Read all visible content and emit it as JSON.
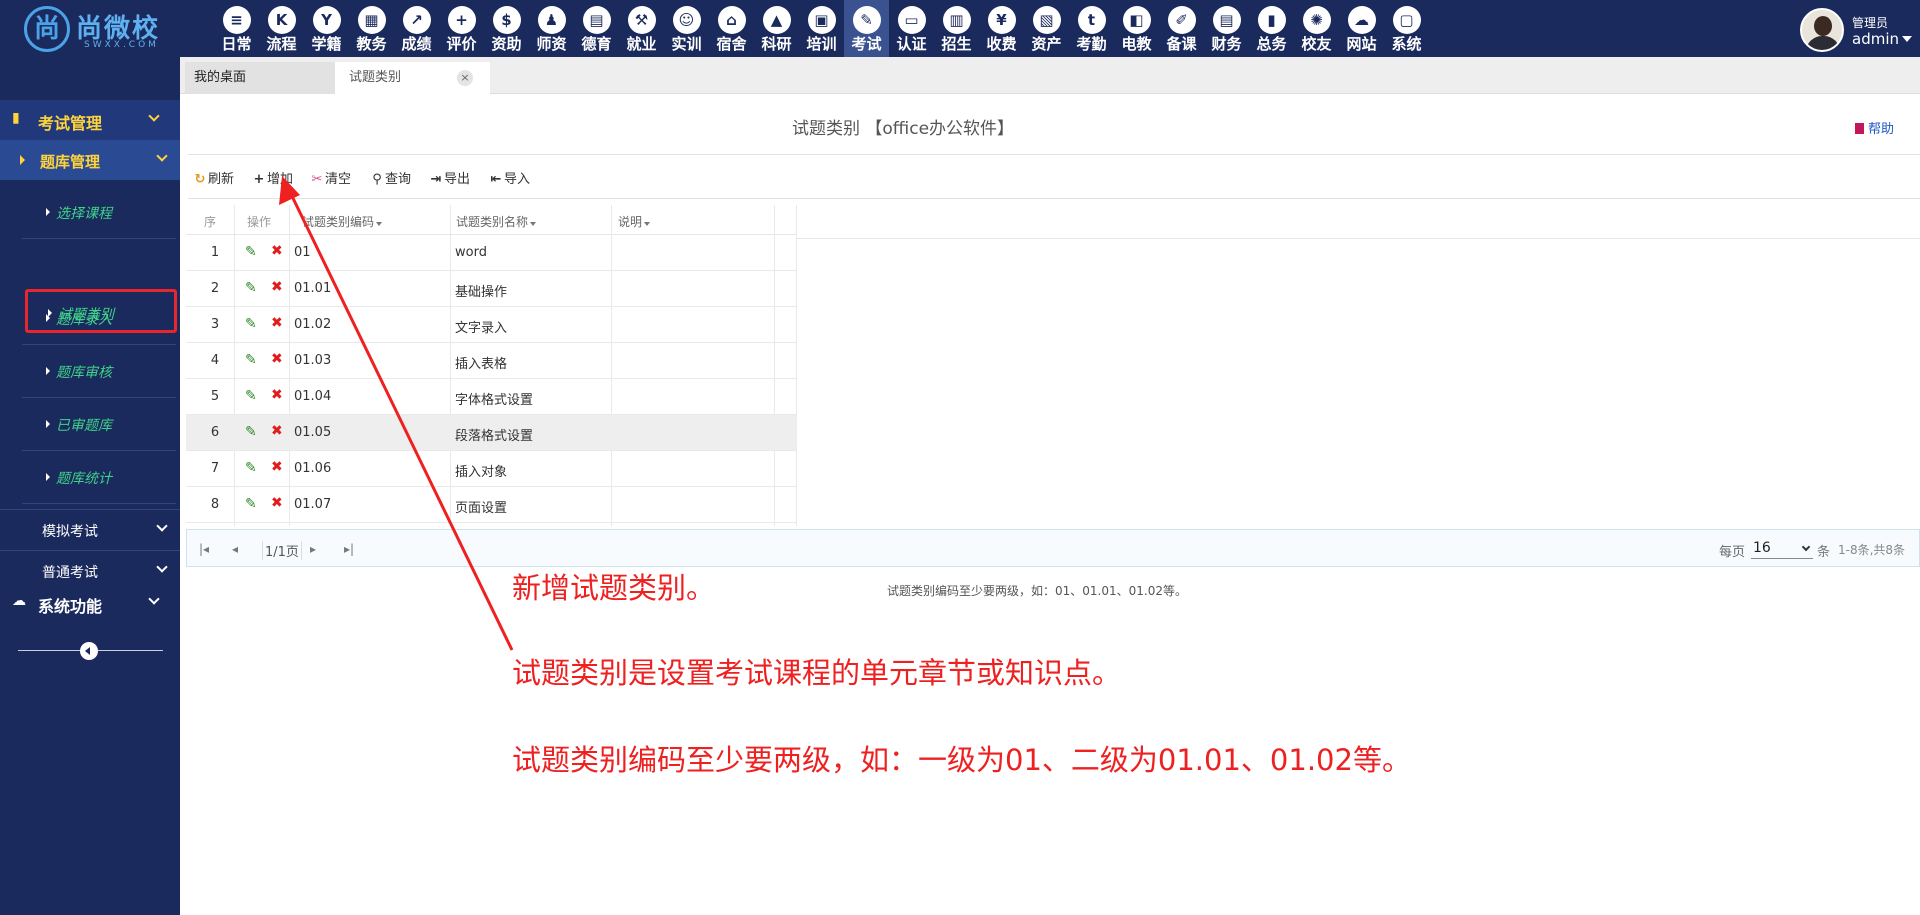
{
  "logo": {
    "mark": "尚",
    "name": "尚微校",
    "sub": "SWXX.COM"
  },
  "modules": [
    "日常",
    "流程",
    "学籍",
    "教务",
    "成绩",
    "评价",
    "资助",
    "师资",
    "德育",
    "就业",
    "实训",
    "宿舍",
    "科研",
    "培训",
    "考试",
    "认证",
    "招生",
    "收费",
    "资产",
    "考勤",
    "电教",
    "备课",
    "财务",
    "总务",
    "校友",
    "网站",
    "系统"
  ],
  "module_icons": [
    "≡",
    "K",
    "Y",
    "▦",
    "↗",
    "+",
    "$",
    "♟",
    "▤",
    "⚒",
    "☺",
    "⌂",
    "▲",
    "▣",
    "✎",
    "▭",
    "▥",
    "¥",
    "▧",
    "t",
    "◧",
    "✐",
    "▤",
    "▮",
    "✺",
    "☁",
    "▢"
  ],
  "active_module_index": 14,
  "user": {
    "role": "管理员",
    "name": "admin"
  },
  "sidebar": {
    "section_exam": "考试管理",
    "section_bank": "题库管理",
    "items": [
      "选择课程",
      "试题类别",
      "题库录入",
      "题库审核",
      "已审题库",
      "题库统计"
    ],
    "selected_index": 1,
    "mock_exam": "模拟考试",
    "regular_exam": "普通考试",
    "system_functions": "系统功能"
  },
  "tabs": {
    "desk": "我的桌面",
    "current": "试题类别",
    "close": "×"
  },
  "page": {
    "title": "试题类别 【office办公软件】",
    "help": "帮助"
  },
  "toolbar": {
    "refresh": "刷新",
    "add": "增加",
    "clear": "清空",
    "query": "查询",
    "export": "导出",
    "import": "导入"
  },
  "table": {
    "headers": {
      "seq": "序",
      "op": "操作",
      "code": "试题类别编码",
      "name": "试题类别名称",
      "desc": "说明"
    },
    "rows": [
      {
        "seq": "1",
        "code": "01",
        "name": "word"
      },
      {
        "seq": "2",
        "code": "01.01",
        "name": "基础操作"
      },
      {
        "seq": "3",
        "code": "01.02",
        "name": "文字录入"
      },
      {
        "seq": "4",
        "code": "01.03",
        "name": "插入表格"
      },
      {
        "seq": "5",
        "code": "01.04",
        "name": "字体格式设置"
      },
      {
        "seq": "6",
        "code": "01.05",
        "name": "段落格式设置"
      },
      {
        "seq": "7",
        "code": "01.06",
        "name": "插入对象"
      },
      {
        "seq": "8",
        "code": "01.07",
        "name": "页面设置"
      }
    ],
    "hover_index": 5
  },
  "pager": {
    "current": "1/1页",
    "per_page_label": "每页",
    "per_page": "16",
    "unit": "条",
    "summary": "1-8条,共8条"
  },
  "hint": "试题类别编码至少要两级，如：01、01.01、01.02等。",
  "annotations": [
    "新增试题类别。",
    "试题类别是设置考试课程的单元章节或知识点。",
    "试题类别编码至少要两级，如：一级为01、二级为01.01、01.02等。"
  ],
  "colors": {
    "nav": "#1b2a5c",
    "accent_yellow": "#ffd43b",
    "sub_item_green": "#3fd28a",
    "highlight_red": "#e8262b",
    "annotation_red": "#ee2020"
  }
}
